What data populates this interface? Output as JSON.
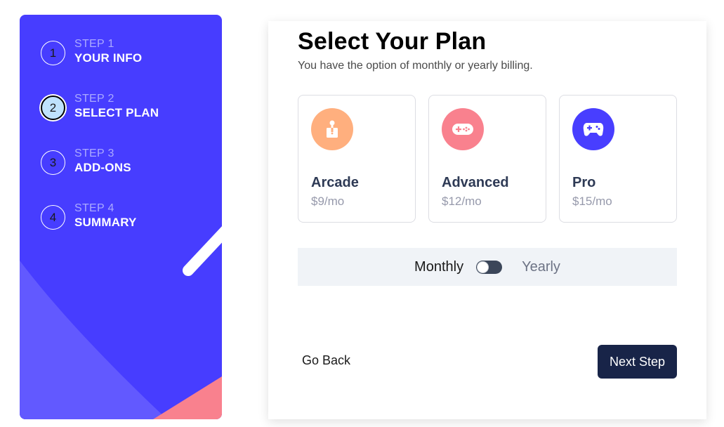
{
  "sidebar": {
    "steps": [
      {
        "number": "1",
        "label": "STEP 1",
        "title": "YOUR INFO",
        "active": false
      },
      {
        "number": "2",
        "label": "STEP 2",
        "title": "SELECT PLAN",
        "active": true
      },
      {
        "number": "3",
        "label": "STEP 3",
        "title": "ADD-ONS",
        "active": false
      },
      {
        "number": "4",
        "label": "STEP 4",
        "title": "SUMMARY",
        "active": false
      }
    ]
  },
  "main": {
    "title": "Select Your Plan",
    "subtitle": "You have the option of monthly or yearly billing.",
    "plans": [
      {
        "name": "Arcade",
        "price": "$9/mo",
        "icon": "arcade-joystick-icon",
        "color": "#ffaf7e"
      },
      {
        "name": "Advanced",
        "price": "$12/mo",
        "icon": "gamepad-icon",
        "color": "#f9818e"
      },
      {
        "name": "Pro",
        "price": "$15/mo",
        "icon": "controller-icon",
        "color": "#483eff"
      }
    ],
    "billing": {
      "monthly": "Monthly",
      "yearly": "Yearly",
      "selected": "Monthly"
    },
    "buttons": {
      "back": "Go Back",
      "next": "Next Step"
    }
  },
  "colors": {
    "sidebar_bg": "#473dff",
    "accent_dark": "#182448",
    "active_step": "#bfe2fd"
  }
}
